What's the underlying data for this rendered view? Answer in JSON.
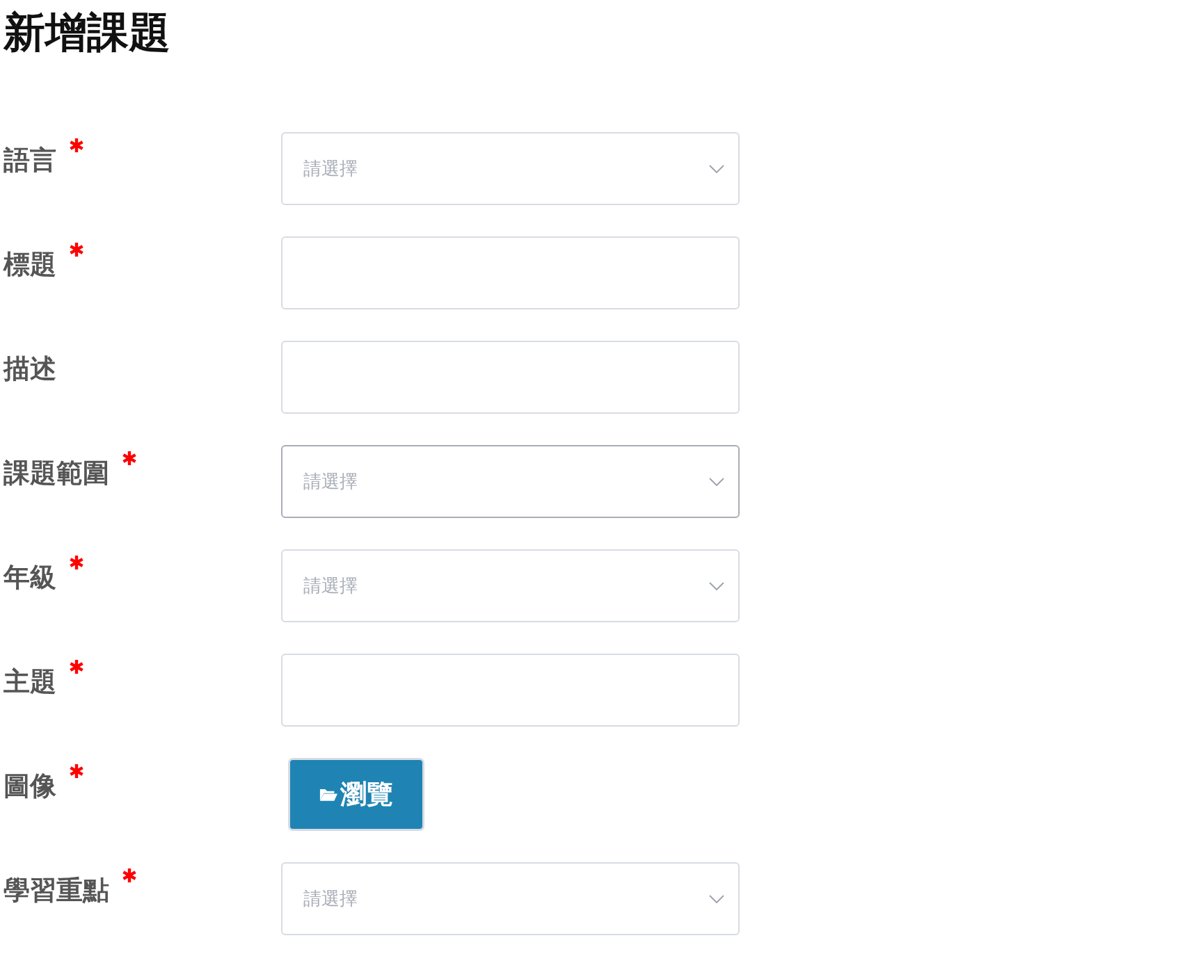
{
  "title": "新增課題",
  "fields": [
    {
      "label": "語言",
      "required": true,
      "kind": "select",
      "placeholder": "請選擇",
      "focused": false
    },
    {
      "label": "標題",
      "required": true,
      "kind": "text",
      "focused": false
    },
    {
      "label": "描述",
      "required": false,
      "kind": "text",
      "focused": false
    },
    {
      "label": "課題範圍",
      "required": true,
      "kind": "select",
      "placeholder": "請選擇",
      "focused": true
    },
    {
      "label": "年級",
      "required": true,
      "kind": "select",
      "placeholder": "請選擇",
      "focused": false
    },
    {
      "label": "主題",
      "required": true,
      "kind": "text",
      "focused": false
    },
    {
      "label": "圖像",
      "required": true,
      "kind": "button",
      "button_label": "瀏覽",
      "focused": false
    },
    {
      "label": "學習重點",
      "required": true,
      "kind": "select",
      "placeholder": "請選擇",
      "focused": false
    }
  ]
}
